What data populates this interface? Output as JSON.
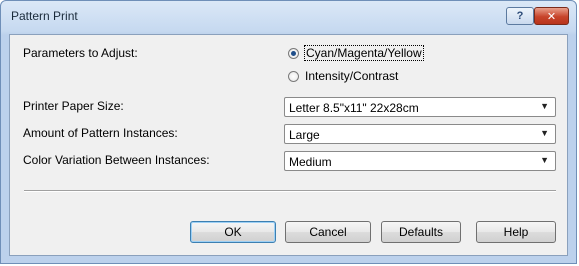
{
  "window": {
    "title": "Pattern Print"
  },
  "titlebar": {
    "help_label": "?",
    "close_label": "✕"
  },
  "params": {
    "label": "Parameters to Adjust:",
    "option1": "Cyan/Magenta/Yellow",
    "option2": "Intensity/Contrast",
    "selected": "option1"
  },
  "paper_size": {
    "label": "Printer Paper Size:",
    "value": "Letter 8.5\"x11\" 22x28cm"
  },
  "instances": {
    "label": "Amount of Pattern Instances:",
    "value": "Large"
  },
  "variation": {
    "label": "Color Variation Between Instances:",
    "value": "Medium"
  },
  "buttons": {
    "ok": "OK",
    "cancel": "Cancel",
    "defaults": "Defaults",
    "help": "Help"
  }
}
